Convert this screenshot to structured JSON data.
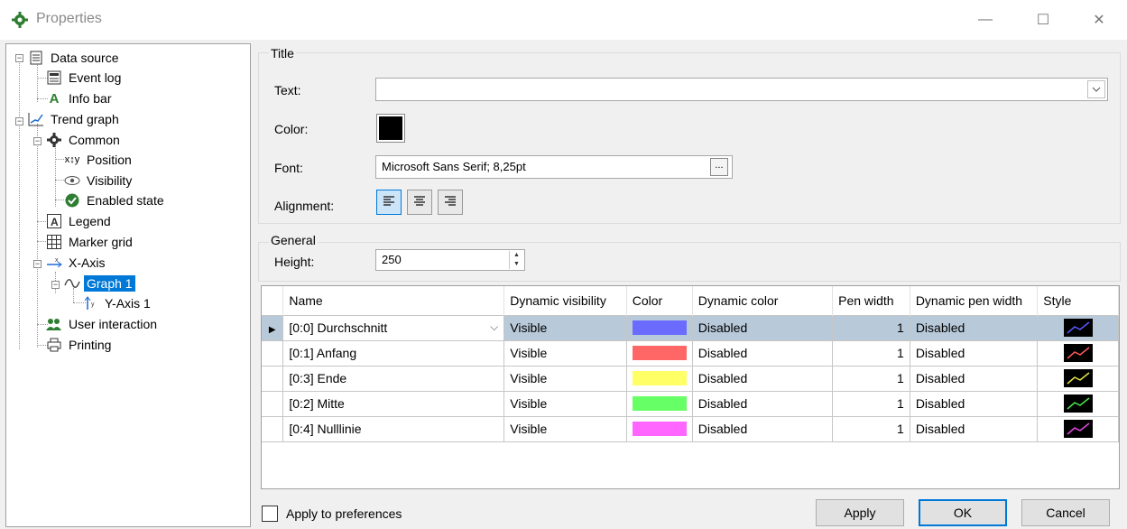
{
  "window": {
    "title": "Properties",
    "icon": "gear-icon",
    "controls": {
      "minimize": "—",
      "maximize": "☐",
      "close": "✕"
    }
  },
  "tree": {
    "items": [
      {
        "label": "Data source",
        "icon": "document-icon"
      },
      {
        "label": "Event log",
        "icon": "log-icon"
      },
      {
        "label": "Info bar",
        "icon": "letter-a-icon"
      },
      {
        "label": "Trend graph",
        "icon": "trend-icon"
      },
      {
        "label": "Common",
        "icon": "gear-icon"
      },
      {
        "label": "Position",
        "icon": "xy-icon"
      },
      {
        "label": "Visibility",
        "icon": "eye-icon"
      },
      {
        "label": "Enabled state",
        "icon": "check-circle-icon"
      },
      {
        "label": "Legend",
        "icon": "legend-icon"
      },
      {
        "label": "Marker grid",
        "icon": "grid-icon"
      },
      {
        "label": "X-Axis",
        "icon": "x-axis-icon"
      },
      {
        "label": "Graph 1",
        "icon": "wave-icon",
        "selected": true
      },
      {
        "label": "Y-Axis 1",
        "icon": "y-axis-icon"
      },
      {
        "label": "User interaction",
        "icon": "users-icon"
      },
      {
        "label": "Printing",
        "icon": "printer-icon"
      }
    ]
  },
  "title_group": {
    "label": "Title",
    "text_label": "Text:",
    "text_value": "",
    "color_label": "Color:",
    "color_value": "#000000",
    "font_label": "Font:",
    "font_value": "Microsoft Sans Serif; 8,25pt",
    "font_button": "...",
    "alignment_label": "Alignment:",
    "alignment_selected": "left"
  },
  "general_group": {
    "label": "General",
    "height_label": "Height:",
    "height_value": "250"
  },
  "grid": {
    "columns": [
      "Name",
      "Dynamic visibility",
      "Color",
      "Dynamic color",
      "Pen width",
      "Dynamic pen width",
      "Style"
    ],
    "rows": [
      {
        "name": "[0:0] Durchschnitt",
        "visibility": "Visible",
        "color": "#6b6bff",
        "dyn_color": "Disabled",
        "pen_width": "1",
        "dyn_pen": "Disabled",
        "style_color": "#5a5aff",
        "current": true
      },
      {
        "name": "[0:1] Anfang",
        "visibility": "Visible",
        "color": "#ff6666",
        "dyn_color": "Disabled",
        "pen_width": "1",
        "dyn_pen": "Disabled",
        "style_color": "#ff5a5a"
      },
      {
        "name": "[0:3] Ende",
        "visibility": "Visible",
        "color": "#ffff66",
        "dyn_color": "Disabled",
        "pen_width": "1",
        "dyn_pen": "Disabled",
        "style_color": "#e6e64a"
      },
      {
        "name": "[0:2] Mitte",
        "visibility": "Visible",
        "color": "#66ff66",
        "dyn_color": "Disabled",
        "pen_width": "1",
        "dyn_pen": "Disabled",
        "style_color": "#4ae64a"
      },
      {
        "name": "[0:4] Nulllinie",
        "visibility": "Visible",
        "color": "#ff66ff",
        "dyn_color": "Disabled",
        "pen_width": "1",
        "dyn_pen": "Disabled",
        "style_color": "#e64ae6"
      }
    ]
  },
  "footer": {
    "apply_prefs_label": "Apply to preferences",
    "apply_button": "Apply",
    "ok_button": "OK",
    "cancel_button": "Cancel"
  },
  "colors": {
    "selection": "#0078d7",
    "current_row": "#b8c9d9"
  }
}
